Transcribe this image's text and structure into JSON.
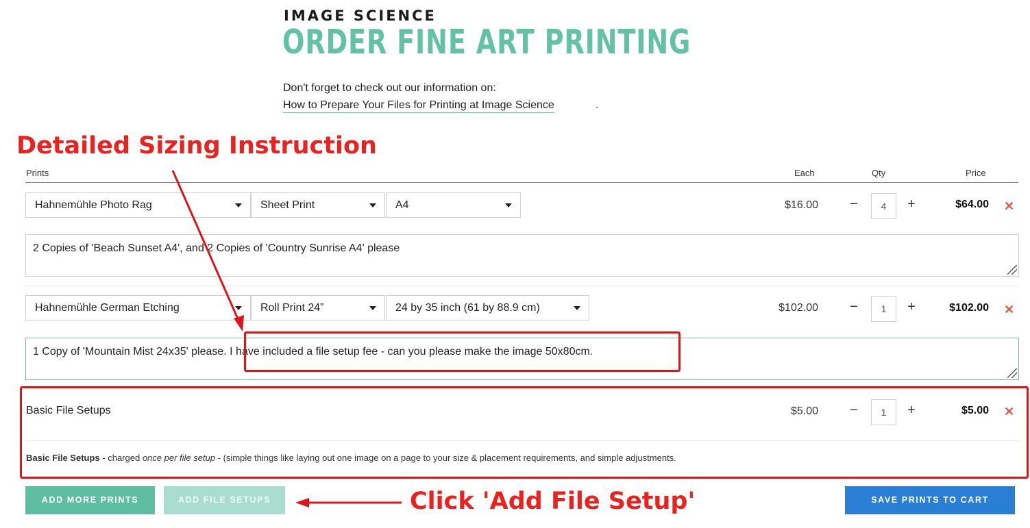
{
  "header": {
    "brand": "IMAGE SCIENCE",
    "title": "ORDER FINE ART PRINTING",
    "info_line": "Don't forget to check out our information on:",
    "info_link": "How to Prepare Your Files for Printing at Image Science",
    "info_period": "."
  },
  "table": {
    "col_prints": "Prints",
    "col_each": "Each",
    "col_qty": "Qty",
    "col_price": "Price"
  },
  "rows": [
    {
      "paper": "Hahnemühle Photo Rag",
      "type": "Sheet Print",
      "size": "A4",
      "each": "$16.00",
      "qty": "4",
      "price": "$64.00",
      "note": "2 Copies of 'Beach Sunset A4', and 2 Copies of 'Country Sunrise A4' please"
    },
    {
      "paper": "Hahnemühle German Etching",
      "type": "Roll Print 24”",
      "size": "24 by 35 inch (61 by 88.9 cm)",
      "each": "$102.00",
      "qty": "1",
      "price": "$102.00",
      "note": "1 Copy of 'Mountain Mist 24x35' please. I have included a file setup fee - can you please make the image 50x80cm."
    }
  ],
  "setup": {
    "name": "Basic File Setups",
    "each": "$5.00",
    "qty": "1",
    "price": "$5.00",
    "desc_bold": "Basic File Setups",
    "desc_a": " - charged ",
    "desc_italic": "once per file setup",
    "desc_b": " - (simple things like laying out one image on a page to your size & placement requirements, and simple adjustments."
  },
  "controls": {
    "minus": "−",
    "plus": "+",
    "remove": "✕"
  },
  "buttons": {
    "add_prints": "ADD MORE PRINTS",
    "add_setups": "ADD FILE SETUPS",
    "save": "SAVE PRINTS TO CART"
  },
  "annotations": {
    "sizing": "Detailed Sizing Instruction",
    "click": "Click 'Add File Setup'",
    "color": "#e8231f"
  },
  "colors": {
    "accent": "#62c2a3",
    "save_button": "#2a7fd4",
    "remove": "#e05a4a"
  }
}
